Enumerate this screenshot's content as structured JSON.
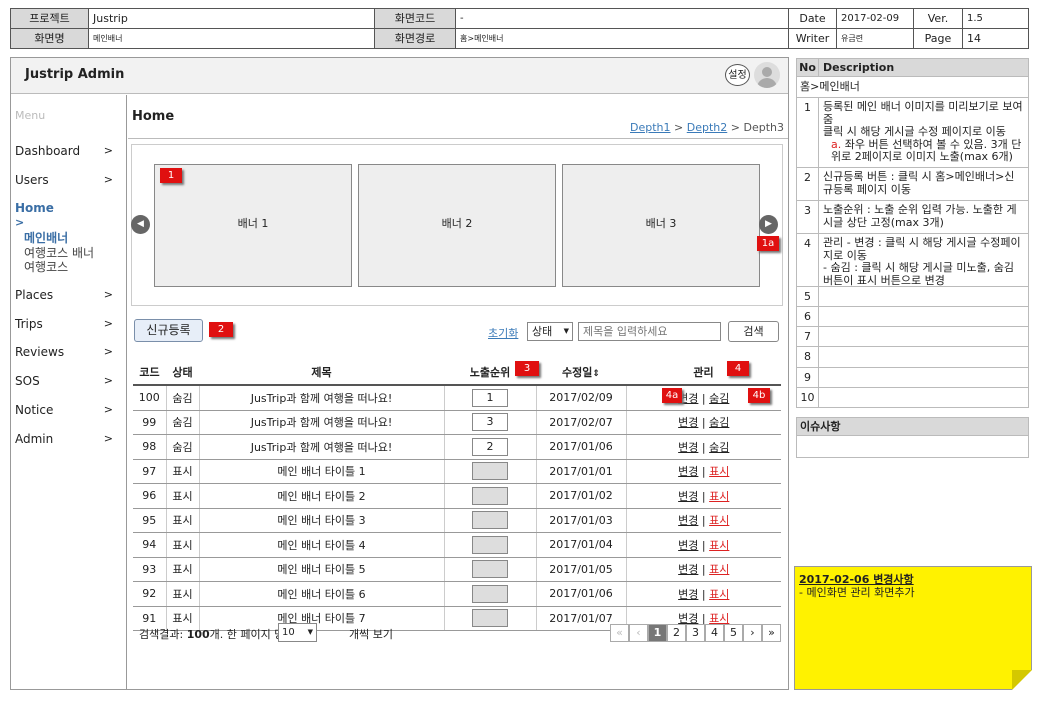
{
  "header": {
    "project_key": "프로젝트",
    "project_val": "Justrip",
    "screen_code_key": "화면코드",
    "screen_code_val": "-",
    "date_key": "Date",
    "date_val": "2017-02-09",
    "ver_key": "Ver.",
    "ver_val": "1.5",
    "screen_name_key": "화면명",
    "screen_name_val": "메인배너",
    "screen_path_key": "화면경로",
    "screen_path_val": "홈>메인배너",
    "writer_key": "Writer",
    "writer_val": "유금련",
    "page_key": "Page",
    "page_val": "14"
  },
  "app": {
    "title": "Justrip Admin",
    "settings_label": "설정",
    "menu_label": "Menu",
    "content_title": "Home",
    "breadcrumb": {
      "d1": "Depth1",
      "sep1": ">",
      "d2": "Depth2",
      "sep2": ">",
      "d3": "Depth3"
    }
  },
  "sidebar": {
    "items": [
      {
        "label": "Dashboard",
        "chev": ">"
      },
      {
        "label": "Users",
        "chev": ">"
      },
      {
        "label": "Home",
        "chev": ">"
      },
      {
        "label": "Places",
        "chev": ">"
      },
      {
        "label": "Trips",
        "chev": ">"
      },
      {
        "label": "Reviews",
        "chev": ">"
      },
      {
        "label": "SOS",
        "chev": ">"
      },
      {
        "label": "Notice",
        "chev": ">"
      },
      {
        "label": "Admin",
        "chev": ">"
      }
    ],
    "sub": [
      "메인배너",
      "여행코스 배너",
      "여행코스"
    ]
  },
  "banners": [
    "배너 1",
    "배너 2",
    "배너 3"
  ],
  "badges": {
    "b1": "1",
    "b1a": "1a",
    "b2": "2",
    "b3": "3",
    "b4": "4",
    "b4a": "4a",
    "b4b": "4b"
  },
  "arrows": {
    "left": "◀",
    "right": "▶"
  },
  "toolbar": {
    "new_button": "신규등록",
    "reset_link": "초기화",
    "status_select": "상태",
    "select_arrow": "▼",
    "search_placeholder": "제목을 입력하세요",
    "search_button": "검색"
  },
  "table": {
    "headers": {
      "code": "코드",
      "status": "상태",
      "title": "제목",
      "order": "노출순위",
      "modified": "수정일",
      "sort_icon": "⇕",
      "manage": "관리"
    },
    "sep": "|",
    "rows": [
      {
        "code": "100",
        "status": "숨김",
        "title": "JusTrip과 함께 여행을 떠나요!",
        "order": "1",
        "date": "2017/02/09",
        "edit": "변경",
        "toggle": "숨김"
      },
      {
        "code": "99",
        "status": "숨김",
        "title": "JusTrip과 함께 여행을 떠나요!",
        "order": "3",
        "date": "2017/02/07",
        "edit": "변경",
        "toggle": "숨김"
      },
      {
        "code": "98",
        "status": "숨김",
        "title": "JusTrip과 함께 여행을 떠나요!",
        "order": "2",
        "date": "2017/01/06",
        "edit": "변경",
        "toggle": "숨김"
      },
      {
        "code": "97",
        "status": "표시",
        "title": "메인 배너 타이틀 1",
        "order": "",
        "date": "2017/01/01",
        "edit": "변경",
        "toggle": "표시"
      },
      {
        "code": "96",
        "status": "표시",
        "title": "메인 배너 타이틀 2",
        "order": "",
        "date": "2017/01/02",
        "edit": "변경",
        "toggle": "표시"
      },
      {
        "code": "95",
        "status": "표시",
        "title": "메인 배너 타이틀 3",
        "order": "",
        "date": "2017/01/03",
        "edit": "변경",
        "toggle": "표시"
      },
      {
        "code": "94",
        "status": "표시",
        "title": "메인 배너 타이틀 4",
        "order": "",
        "date": "2017/01/04",
        "edit": "변경",
        "toggle": "표시"
      },
      {
        "code": "93",
        "status": "표시",
        "title": "메인 배너 타이틀 5",
        "order": "",
        "date": "2017/01/05",
        "edit": "변경",
        "toggle": "표시"
      },
      {
        "code": "92",
        "status": "표시",
        "title": "메인 배너 타이틀 6",
        "order": "",
        "date": "2017/01/06",
        "edit": "변경",
        "toggle": "표시"
      },
      {
        "code": "91",
        "status": "표시",
        "title": "메인 배너 타이틀 7",
        "order": "",
        "date": "2017/01/07",
        "edit": "변경",
        "toggle": "표시"
      }
    ]
  },
  "footer": {
    "result_prefix": "검색결과: ",
    "result_count": "100",
    "result_suffix": "개. 한 페이지 당",
    "per_page": "10",
    "per_page_arrow": "▼",
    "per_page_suffix": "개씩 보기",
    "pager": [
      "«",
      "‹",
      "1",
      "2",
      "3",
      "4",
      "5",
      "›",
      "»"
    ],
    "current_page": "1"
  },
  "desc_panel": {
    "col_no": "No",
    "col_desc": "Description",
    "path": "홈>메인배너",
    "items": [
      {
        "no": "1",
        "lines": [
          "등록된 메인 배너 이미지를 미리보기로 보여 줌",
          "클릭 시 해당 게시글 수정 페이지로 이동"
        ],
        "sub_mark": "a.",
        "sub_text": "좌우 버튼 선택하여 볼 수 있음. 3개 단위로 2페이지로 이미지 노출(max 6개)"
      },
      {
        "no": "2",
        "lines": [
          "신규등록 버튼 : 클릭 시 홈>메인배너>신규등록 페이지 이동"
        ]
      },
      {
        "no": "3",
        "lines": [
          "노출순위 : 노출 순위 입력 가능. 노출한 게시글 상단 고정(max 3개)"
        ]
      },
      {
        "no": "4",
        "lines": [
          "관리 - 변경 : 클릭 시 해당 게시글 수정페이지로 이동",
          "- 숨김 : 클릭 시 해당 게시글 미노출, 숨김 버튼이 표시 버튼으로 변경"
        ]
      },
      {
        "no": "5",
        "lines": []
      },
      {
        "no": "6",
        "lines": []
      },
      {
        "no": "7",
        "lines": []
      },
      {
        "no": "8",
        "lines": []
      },
      {
        "no": "9",
        "lines": []
      },
      {
        "no": "10",
        "lines": []
      }
    ],
    "issue_label": "이슈사항"
  },
  "sticky": {
    "title": "2017-02-06 변경사항",
    "body": "- 메인화면 관리 화면추가",
    "color": "#fff200"
  }
}
